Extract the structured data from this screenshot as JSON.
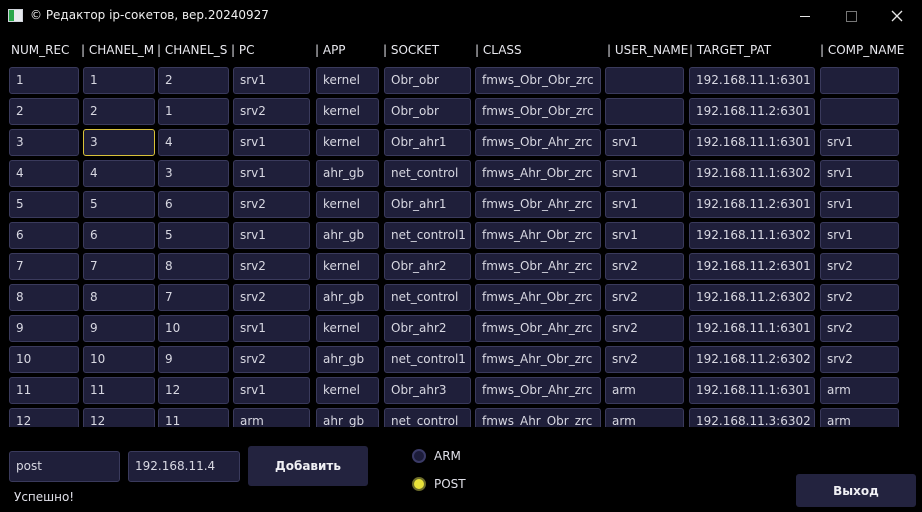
{
  "window": {
    "title": "© Редактор ip-сокетов, вер.20240927"
  },
  "table": {
    "columns": [
      "NUM_REC",
      "| CHANEL_M",
      "| CHANEL_S",
      "| PC",
      "| APP",
      "| SOCKET",
      "| CLASS",
      "| USER_NAME",
      "| TARGET_PAT",
      "| COMP_NAME"
    ],
    "rows": [
      [
        "1",
        "1",
        "2",
        "srv1",
        "kernel",
        "Obr_obr",
        "fmws_Obr_Obr_zrc",
        "",
        "192.168.11.1:6301",
        ""
      ],
      [
        "2",
        "2",
        "1",
        "srv2",
        "kernel",
        "Obr_obr",
        "fmws_Obr_Obr_zrc",
        "",
        "192.168.11.2:6301",
        ""
      ],
      [
        "3",
        "3",
        "4",
        "srv1",
        "kernel",
        "Obr_ahr1",
        "fmws_Obr_Ahr_zrc",
        "srv1",
        "192.168.11.1:6301",
        "srv1"
      ],
      [
        "4",
        "4",
        "3",
        "srv1",
        "ahr_gb",
        "net_control",
        "fmws_Ahr_Obr_zrc",
        "srv1",
        "192.168.11.1:6302",
        "srv1"
      ],
      [
        "5",
        "5",
        "6",
        "srv2",
        "kernel",
        "Obr_ahr1",
        "fmws_Obr_Ahr_zrc",
        "srv1",
        "192.168.11.2:6301",
        "srv1"
      ],
      [
        "6",
        "6",
        "5",
        "srv1",
        "ahr_gb",
        "net_control1",
        "fmws_Ahr_Obr_zrc",
        "srv1",
        "192.168.11.1:6302",
        "srv1"
      ],
      [
        "7",
        "7",
        "8",
        "srv2",
        "kernel",
        "Obr_ahr2",
        "fmws_Obr_Ahr_zrc",
        "srv2",
        "192.168.11.2:6301",
        "srv2"
      ],
      [
        "8",
        "8",
        "7",
        "srv2",
        "ahr_gb",
        "net_control",
        "fmws_Ahr_Obr_zrc",
        "srv2",
        "192.168.11.2:6302",
        "srv2"
      ],
      [
        "9",
        "9",
        "10",
        "srv1",
        "kernel",
        "Obr_ahr2",
        "fmws_Obr_Ahr_zrc",
        "srv2",
        "192.168.11.1:6301",
        "srv2"
      ],
      [
        "10",
        "10",
        "9",
        "srv2",
        "ahr_gb",
        "net_control1",
        "fmws_Ahr_Obr_zrc",
        "srv2",
        "192.168.11.2:6302",
        "srv2"
      ],
      [
        "11",
        "11",
        "12",
        "srv1",
        "kernel",
        "Obr_ahr3",
        "fmws_Obr_Ahr_zrc",
        "arm",
        "192.168.11.1:6301",
        "arm"
      ],
      [
        "12",
        "12",
        "11",
        "arm",
        "ahr_gb",
        "net_control",
        "fmws_Ahr_Obr_zrc",
        "arm",
        "192.168.11.3:6302",
        "arm"
      ]
    ],
    "focused_cell": {
      "row": 2,
      "col": 1
    }
  },
  "bottom": {
    "name_value": "post",
    "ip_value": "192.168.11.4",
    "add_label": "Добавить",
    "radio_arm": "ARM",
    "radio_post": "POST",
    "selected_radio": "POST",
    "status_text": "Успешно!",
    "exit_label": "Выход"
  },
  "colors": {
    "background": "#000000",
    "cell_bg": "#1f1f3a",
    "cell_border": "#3a3a5c",
    "focus_border": "#d8c13a",
    "radio_checked": "#e8e23a"
  }
}
